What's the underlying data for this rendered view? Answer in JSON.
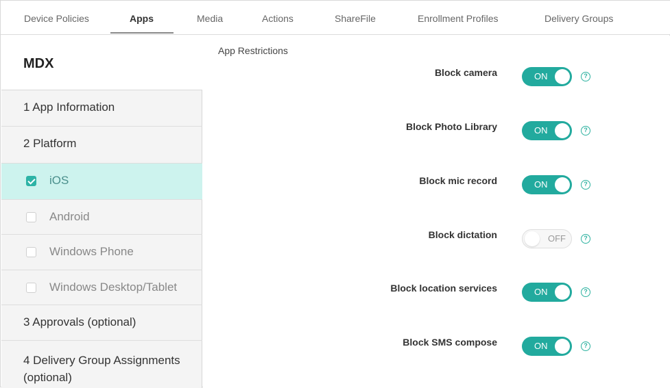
{
  "tabs": [
    {
      "label": "Device Policies",
      "active": false
    },
    {
      "label": "Apps",
      "active": true
    },
    {
      "label": "Media",
      "active": false
    },
    {
      "label": "Actions",
      "active": false
    },
    {
      "label": "ShareFile",
      "active": false
    },
    {
      "label": "Enrollment Profiles",
      "active": false
    },
    {
      "label": "Delivery Groups",
      "active": false
    }
  ],
  "sidebar": {
    "title": "MDX",
    "items": [
      {
        "label": "1  App Information"
      },
      {
        "label": "2  Platform"
      },
      {
        "label": "iOS",
        "checked": true,
        "selected": true
      },
      {
        "label": "Android",
        "checked": false
      },
      {
        "label": "Windows Phone",
        "checked": false
      },
      {
        "label": "Windows Desktop/Tablet",
        "checked": false
      },
      {
        "label": "3  Approvals (optional)"
      },
      {
        "label": "4  Delivery Group Assignments (optional)"
      }
    ]
  },
  "main": {
    "section_title": "App Restrictions",
    "restrictions": [
      {
        "label": "Block camera",
        "state": "ON",
        "help": "?"
      },
      {
        "label": "Block Photo Library",
        "state": "ON",
        "help": "?"
      },
      {
        "label": "Block mic record",
        "state": "ON",
        "help": "?"
      },
      {
        "label": "Block dictation",
        "state": "OFF",
        "help": "?"
      },
      {
        "label": "Block location services",
        "state": "ON",
        "help": "?"
      },
      {
        "label": "Block SMS compose",
        "state": "ON",
        "help": "?"
      }
    ]
  },
  "colors": {
    "accent": "#22aa9e",
    "selected_bg": "#cdf3ee",
    "sidebar_bg": "#f4f4f4"
  }
}
